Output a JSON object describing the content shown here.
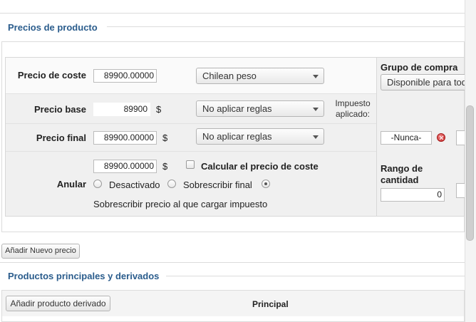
{
  "sections": {
    "prices_title": "Precios de producto",
    "related_title": "Productos principales y derivados"
  },
  "price_row_cost": {
    "label": "Precio de coste",
    "value": "89900.00000",
    "currency_select": "Chilean peso"
  },
  "price_row_base": {
    "label": "Precio base",
    "value": "89900",
    "currency_symbol": "$",
    "rules_select": "No aplicar reglas",
    "tax_label": "Impuesto aplicado:"
  },
  "price_row_final": {
    "label": "Precio final",
    "value": "89900.00000",
    "currency_symbol": "$",
    "rules_select": "No aplicar reglas",
    "date_value": "-Nunca-"
  },
  "override_row": {
    "label": "Anular",
    "value": "89900.00000",
    "currency_symbol": "$",
    "calc_cost_label": "Calcular el precio de coste",
    "calc_cost_checked": false,
    "radio_disabled_label": "Desactivado",
    "radio_override_label": "Sobrescribir final",
    "selected_radio": "third",
    "override_tax_text": "Sobrescribir precio al que cargar impuesto"
  },
  "right_column": {
    "purchase_group_label": "Grupo de compra",
    "purchase_group_select": "Disponible para todos",
    "qty_range_label": "Rango de cantidad",
    "qty_value": "0"
  },
  "buttons": {
    "add_price": "Añadir Nuevo precio",
    "add_derived": "Añadir producto derivado"
  },
  "table": {
    "principal_header": "Principal"
  },
  "colors": {
    "section_title": "#2a5c8c",
    "panel_bg": "#f0f0f0",
    "delete_icon": "#c82323"
  }
}
